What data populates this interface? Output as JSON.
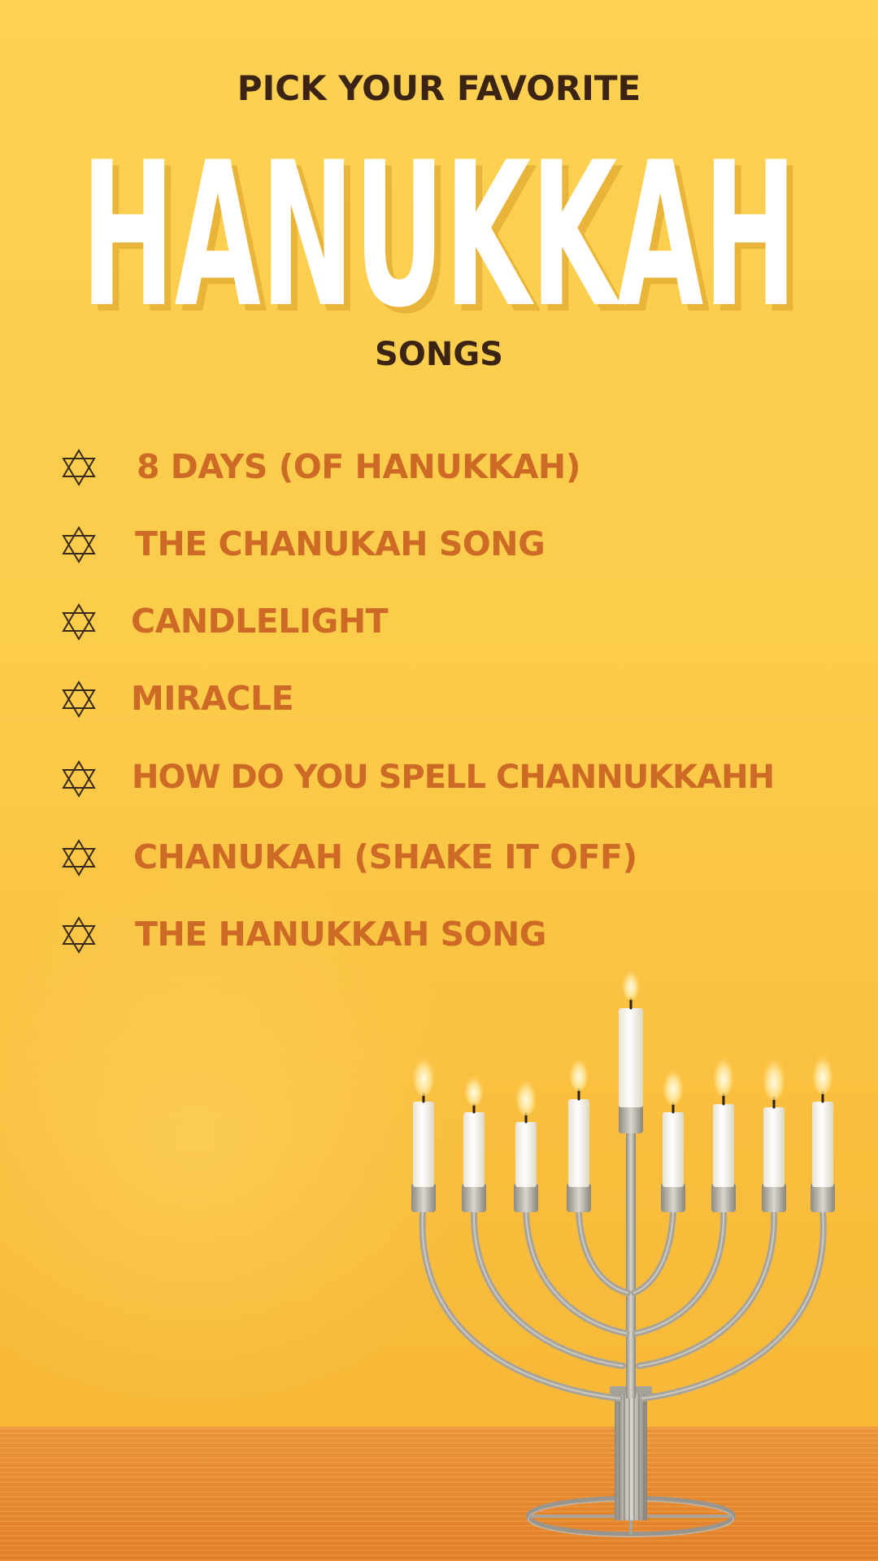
{
  "poster": {
    "kicker": "PICK YOUR FAVORITE",
    "headline": "HANUKKAH",
    "subhead": "SONGS",
    "songs": [
      "8 DAYS (OF HANUKKAH)",
      "THE CHANUKAH SONG",
      "CANDLELIGHT",
      "MIRACLE",
      "HOW DO YOU SPELL CHANNUKKAHH",
      "CHANUKAH (SHAKE IT OFF)",
      "THE HANUKKAH SONG"
    ],
    "bullet_icon": "star-of-david-icon"
  },
  "colors": {
    "background": "#fdd152",
    "kicker_text": "#3b2414",
    "headline_fill": "#ffffff",
    "headline_shadow": "#e9b43a",
    "song_text": "#cc6a26",
    "bullet_stroke": "#3a2a1a",
    "table": "#ee9033"
  },
  "image": {
    "subject": "menorah-photo"
  }
}
